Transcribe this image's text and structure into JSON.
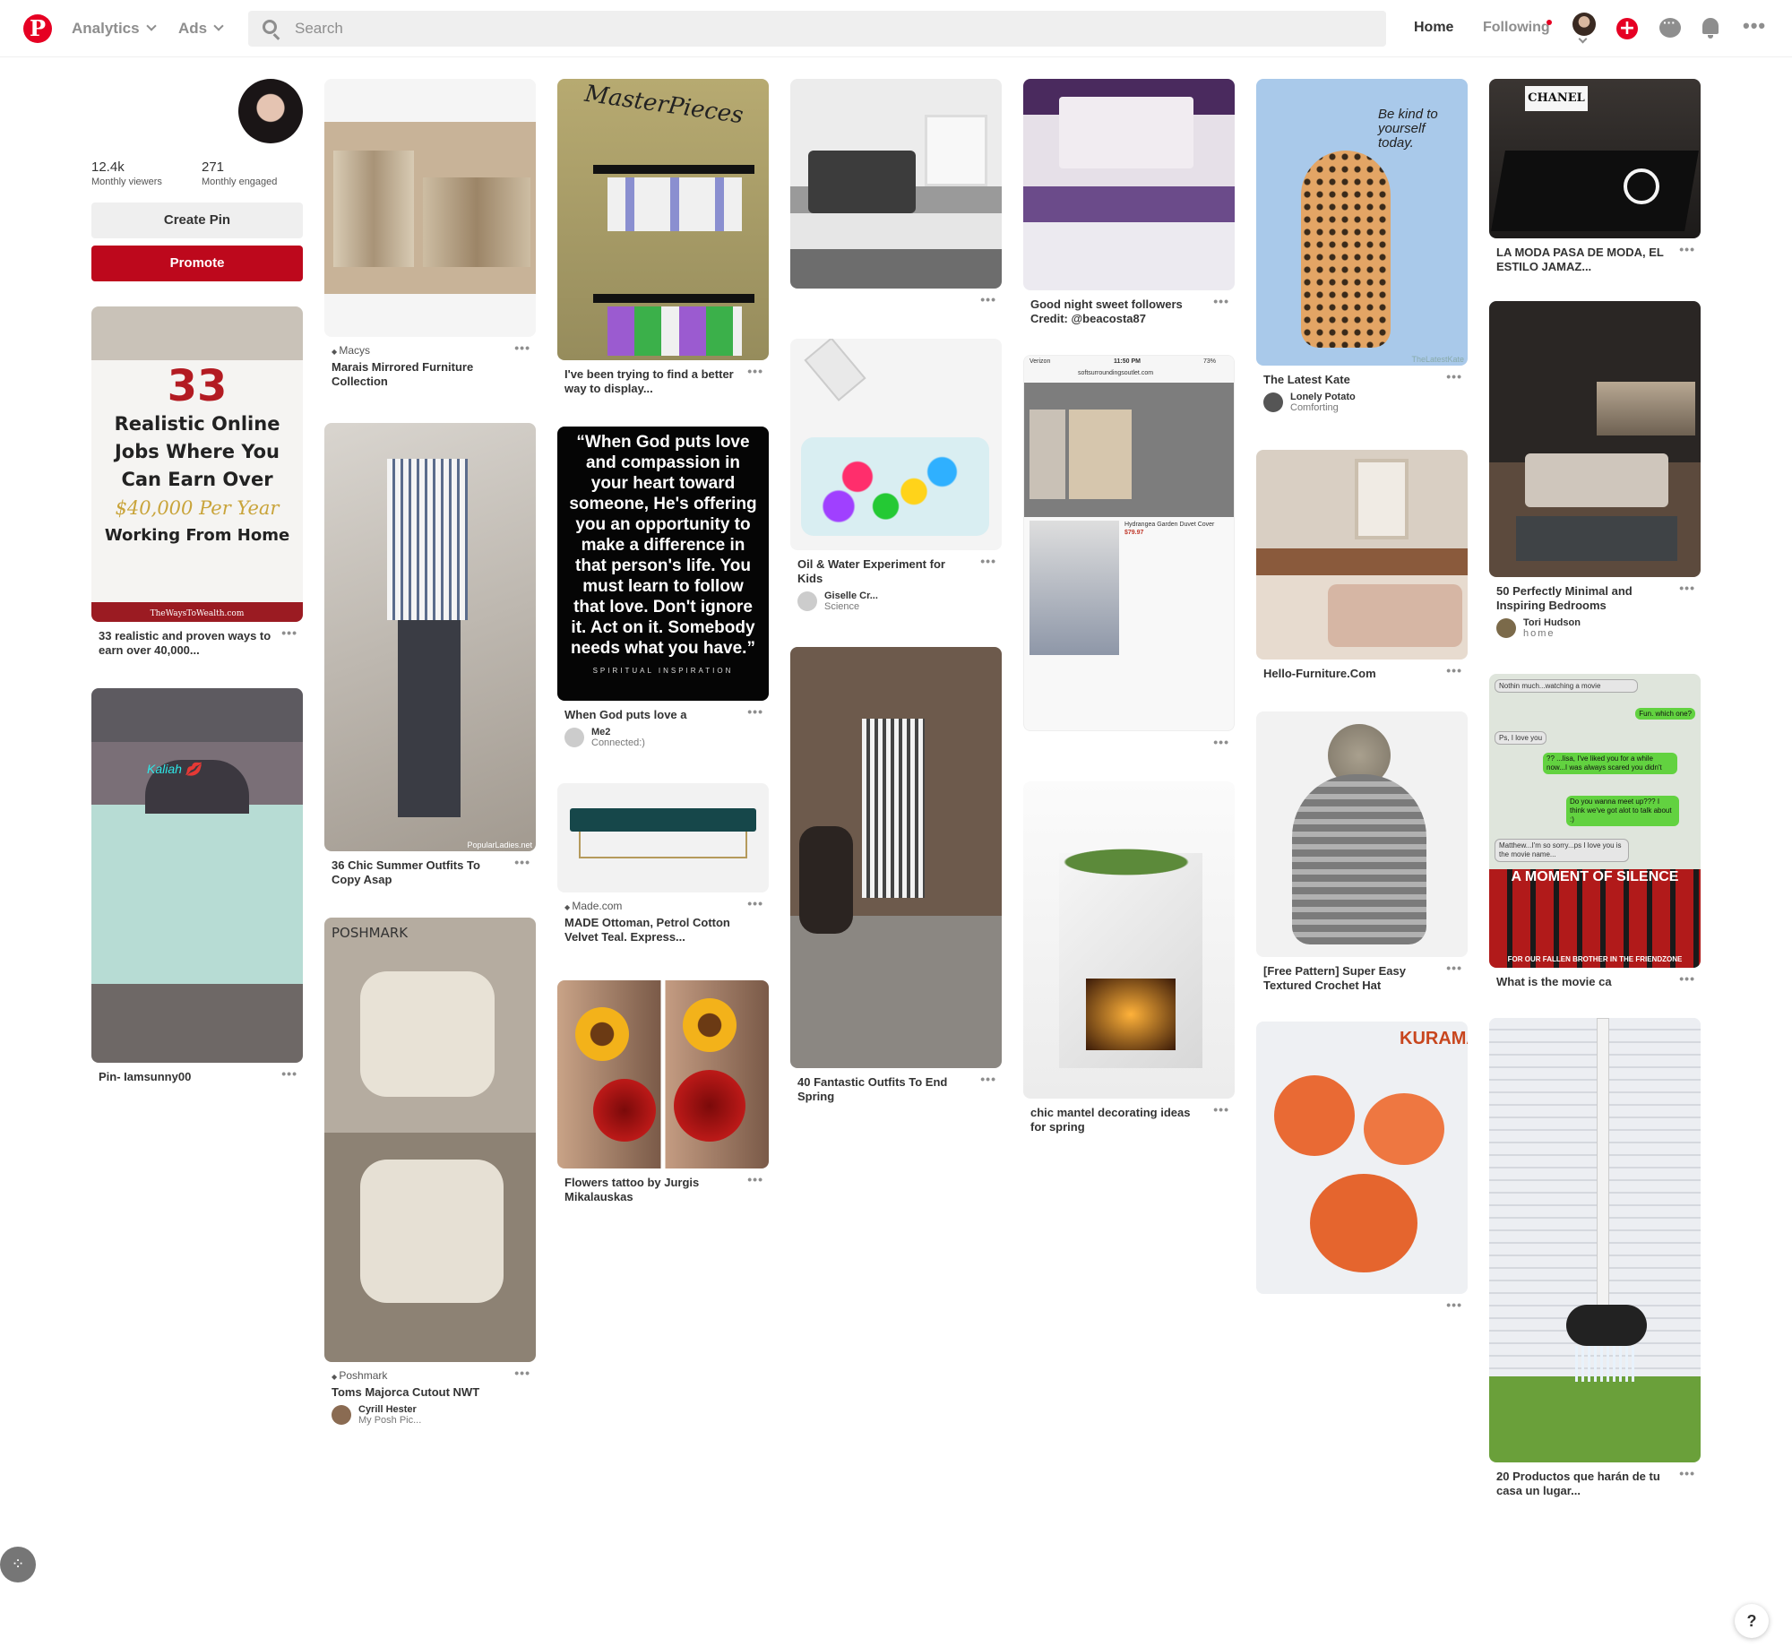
{
  "header": {
    "logo": "P",
    "analytics_label": "Analytics",
    "ads_label": "Ads",
    "search_placeholder": "Search",
    "home_label": "Home",
    "following_label": "Following",
    "more_label": "•••"
  },
  "profile": {
    "viewers_value": "12.4k",
    "viewers_label": "Monthly viewers",
    "engaged_value": "271",
    "engaged_label": "Monthly engaged",
    "create_pin_label": "Create Pin",
    "promote_label": "Promote"
  },
  "pins": {
    "c1a": {
      "title": "33 realistic and proven ways to earn over 40,000...",
      "overlay": {
        "num": "33",
        "l1": "Realistic Online",
        "l2": "Jobs Where You",
        "l3": "Can Earn Over",
        "l4": "$40,000 Per Year",
        "l5": "Working From Home",
        "footer": "TheWaysToWealth.com"
      }
    },
    "c1b": {
      "title": "Pin- Iamsunny00",
      "overlay": "Kaliah 💋"
    },
    "c2a": {
      "domain": "Macys",
      "title": "Marais Mirrored Furniture Collection"
    },
    "c2b": {
      "title": "36 Chic Summer Outfits To Copy Asap",
      "watermark": "PopularLadies.net"
    },
    "c2c": {
      "brand": "POSHMARK",
      "domain": "Poshmark",
      "title": "Toms Majorca Cutout NWT",
      "pinner": "Cyrill Hester",
      "board": "My Posh Pic..."
    },
    "c3a": {
      "title": "I've been trying to find a better way to display...",
      "overlay": "MasterPieces"
    },
    "c3b": {
      "quote": "“When God puts love and compassion in your heart toward someone, He's offering you an opportunity to make a difference in that person's life. You must learn to follow that love. Don't ignore it. Act on it. Somebody needs what you have.”",
      "quote_source": "SPIRITUAL INSPIRATION",
      "title": "When God puts love a",
      "pinner": "Me2",
      "board": "Connected:)"
    },
    "c3c": {
      "domain": "Made.com",
      "title": "MADE Ottoman, Petrol Cotton Velvet Teal. Express..."
    },
    "c3d": {
      "title": "Flowers tattoo by Jurgis Mikalauskas"
    },
    "c4a": {
      "title": ""
    },
    "c4b": {
      "title": "Oil & Water Experiment for Kids",
      "pinner": "Giselle Cr...",
      "board": "Science"
    },
    "c4c": {
      "title": "40 Fantastic Outfits To End Spring"
    },
    "c5a": {
      "title": "Good night sweet followers Credit: @beacosta87"
    },
    "c5b": {
      "status_carrier": "Verizon",
      "status_time": "11:50 PM",
      "status_batt": "73%",
      "url": "softsurroundingsoutlet.com",
      "product": "Hydrangea Garden Duvet Cover",
      "price": "$79.97"
    },
    "c5c": {
      "title": "chic mantel decorating ideas for spring"
    },
    "c6a": {
      "overlay": "Be kind to yourself today.",
      "watermark": "TheLatestKate",
      "title": "The Latest Kate",
      "pinner": "Lonely Potato",
      "board": "Comforting"
    },
    "c6b": {
      "title": "Hello-Furniture.Com"
    },
    "c6c": {
      "title": "[Free Pattern] Super Easy Textured Crochet Hat"
    },
    "c6d": {
      "overlay": "KURAMA"
    },
    "c7a": {
      "brand": "CHANEL",
      "title": "LA MODA PASA DE MODA, EL ESTILO JAMAZ..."
    },
    "c7b": {
      "title": "50 Perfectly Minimal and Inspiring Bedrooms",
      "pinner": "Tori Hudson",
      "board": "home"
    },
    "c7c": {
      "chat": [
        "Nothin much...watching a movie",
        "Fun. which one?",
        "Ps, I love you",
        "?? ...lisa, I've liked you for a while now...I was always scared you didn't",
        "Do you wanna meet up??? I think we've got alot to talk about :)",
        "Matthew...I'm so sorry...ps I love you is the movie name..."
      ],
      "banner": "A MOMENT OF SILENCE",
      "footer": "FOR OUR FALLEN BROTHER IN THE FRIENDZONE",
      "title": "What is the movie ca"
    },
    "c7d": {
      "title": "20 Productos que harán de tu casa un lugar..."
    }
  },
  "dots_label": "•••",
  "help_label": "?",
  "apps_label": "⁘"
}
